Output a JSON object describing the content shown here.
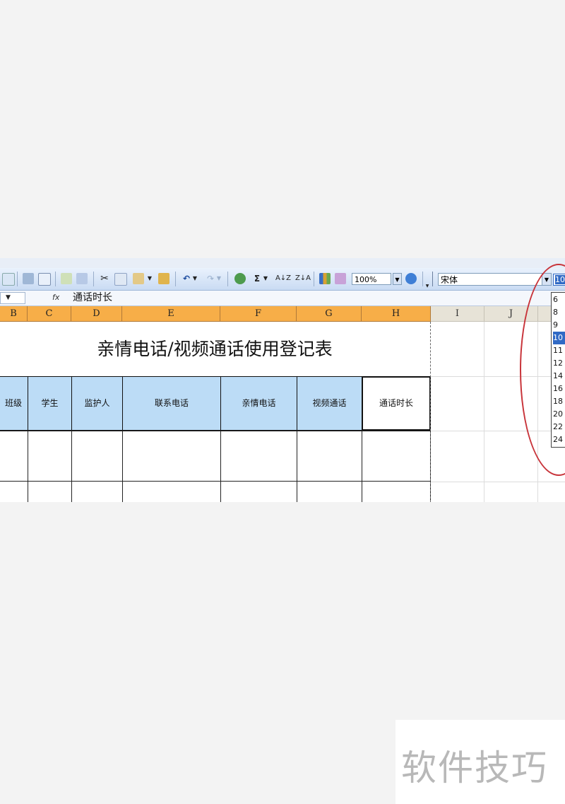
{
  "toolbar": {
    "zoom": "100%",
    "font_name": "宋体",
    "font_size": "10",
    "sum_symbol": "Σ",
    "sort_asc": "A↓Z",
    "sort_desc": "Z↓A"
  },
  "formula_bar": {
    "fx": "fx",
    "content": "通话时长"
  },
  "columns": [
    "B",
    "C",
    "D",
    "E",
    "F",
    "G",
    "H",
    "I",
    "J"
  ],
  "sheet": {
    "title": "亲情电话/视频通话使用登记表",
    "headers": [
      "班级",
      "学生",
      "监护人",
      "联系电话",
      "亲情电话",
      "视频通话",
      "通话时长"
    ]
  },
  "font_size_list": [
    "6",
    "8",
    "9",
    "10",
    "11",
    "12",
    "14",
    "16",
    "18",
    "20",
    "22",
    "24"
  ],
  "font_size_selected": "10",
  "watermark": "软件技巧",
  "colors": {
    "selected_column_header": "#f7ae48",
    "table_header_fill": "#bcdcf6",
    "annotation_circle": "#c8343a",
    "highlight": "#316ac5"
  }
}
